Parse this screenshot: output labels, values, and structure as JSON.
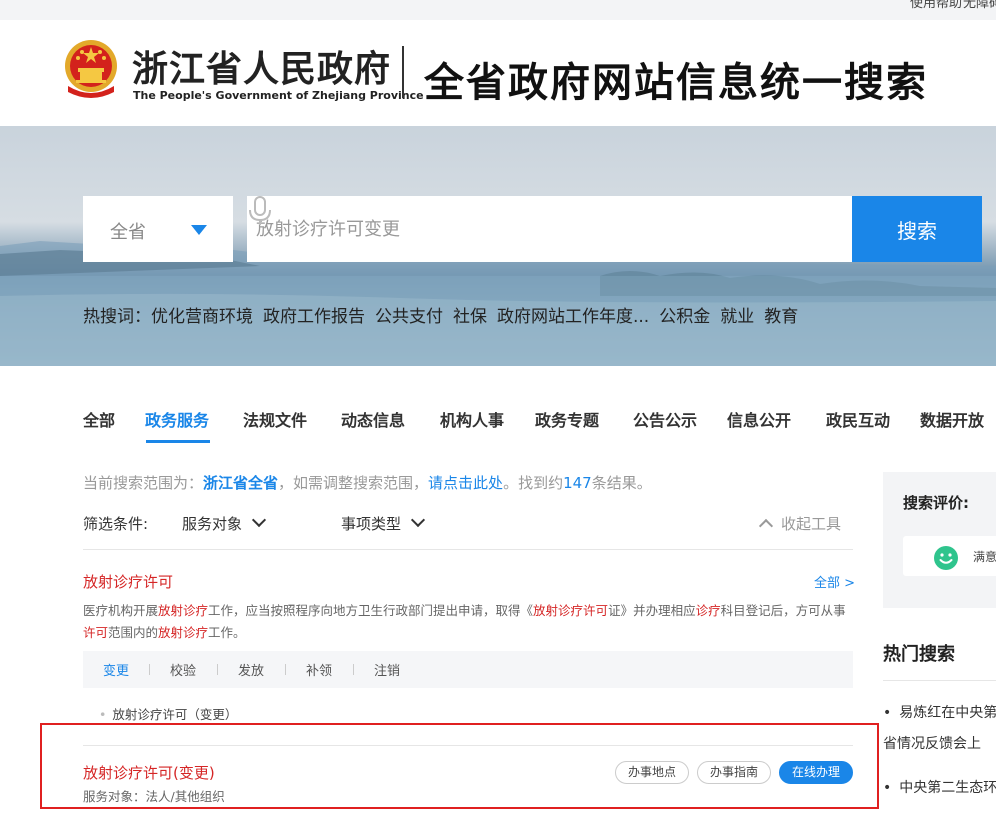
{
  "topbar": {
    "link1": "使用帮助",
    "link2": "无障碍"
  },
  "header": {
    "logo_cn": "浙江省人民政府",
    "logo_en": "The People's Government of Zhejiang Province",
    "slogan": "全省政府网站信息统一搜索"
  },
  "search": {
    "scope": "全省",
    "placeholder": "放射诊疗许可变更",
    "button": "搜索"
  },
  "hot_words": {
    "label": "热搜词：",
    "items": [
      "优化营商环境",
      "政府工作报告",
      "公共支付",
      "社保",
      "政府网站工作年度...",
      "公积金",
      "就业",
      "教育"
    ]
  },
  "tabs": [
    "全部",
    "政务服务",
    "法规文件",
    "动态信息",
    "机构人事",
    "政务专题",
    "公告公示",
    "信息公开",
    "政民互动",
    "数据开放"
  ],
  "scope_line": {
    "prefix": "当前搜索范围为：",
    "scope": "浙江省全省",
    "mid": "，如需调整搜索范围，",
    "link": "请点击此处",
    "found_prefix": "。找到约",
    "count": "147",
    "found_suffix": "条结果。"
  },
  "filter": {
    "label": "筛选条件:",
    "target": "服务对象",
    "type": "事项类型",
    "collapse": "收起工具"
  },
  "result1": {
    "title": "放射诊疗许可",
    "all": "全部 >",
    "desc": [
      {
        "t": "医疗机构开展",
        "h": false
      },
      {
        "t": "放射诊疗",
        "h": true
      },
      {
        "t": "工作，应当按照程序向地方卫生行政部门提出申请，取得《",
        "h": false
      },
      {
        "t": "放射诊疗许可",
        "h": true
      },
      {
        "t": "证》并办理相应",
        "h": false
      },
      {
        "t": "诊疗",
        "h": true
      },
      {
        "t": "科目登记后，方可从事",
        "h": false
      },
      {
        "t": "许可",
        "h": true
      },
      {
        "t": "范围内的",
        "h": false
      },
      {
        "t": "放射诊疗",
        "h": true
      },
      {
        "t": "工作。",
        "h": false
      }
    ],
    "subtabs": [
      "变更",
      "校验",
      "发放",
      "补领",
      "注销"
    ],
    "sub_item": "放射诊疗许可（变更）"
  },
  "result2": {
    "title": "放射诊疗许可(变更)",
    "meta": "服务对象：法人/其他组织",
    "btn_location": "办事地点",
    "btn_guide": "办事指南",
    "btn_online": "在线办理"
  },
  "sidebar": {
    "eval_title": "搜索评价:",
    "eval_option": "满意",
    "hot_title": "热门搜索",
    "hot_items": [
      "易炼红在中央第",
      "中央第二生态环"
    ],
    "hot_item1_line2": "省情况反馈会上"
  },
  "colors": {
    "accent": "#1a86e8",
    "highlight": "#d52626",
    "box": "#e02020"
  }
}
